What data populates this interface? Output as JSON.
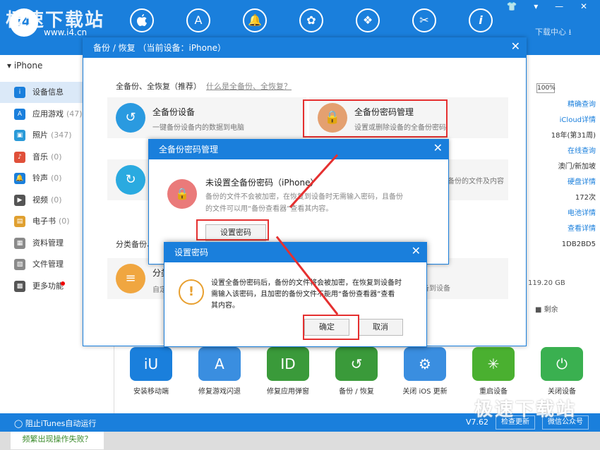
{
  "app": {
    "brand": "极速下载站",
    "url": "www.i4.cn",
    "logo": "i4",
    "download_center": "下载中心 ⭳",
    "window_controls": "👕 ▾ — ✕"
  },
  "nav_icons": [
    "apple-icon",
    "appstore-icon",
    "bell-icon",
    "flower-icon",
    "dropbox-icon",
    "tools-icon",
    "info-icon"
  ],
  "nav_glyphs": [
    "",
    "A",
    "🔔",
    "✿",
    "❖",
    "✂",
    "i"
  ],
  "sidebar": {
    "device": "iPhone",
    "items": [
      {
        "label": "设备信息",
        "count": "",
        "color": "#1a7fdc",
        "glyph": "i"
      },
      {
        "label": "应用游戏",
        "count": "(47)",
        "color": "#1a7fdc",
        "glyph": "A"
      },
      {
        "label": "照片",
        "count": "(347)",
        "color": "#2a9ad8",
        "glyph": "▣"
      },
      {
        "label": "音乐",
        "count": "(0)",
        "color": "#e0503a",
        "glyph": "♪"
      },
      {
        "label": "铃声",
        "count": "(0)",
        "color": "#1a7fdc",
        "glyph": "🔔"
      },
      {
        "label": "视频",
        "count": "(0)",
        "color": "#555555",
        "glyph": "▶"
      },
      {
        "label": "电子书",
        "count": "(0)",
        "color": "#e0a030",
        "glyph": "▤"
      },
      {
        "label": "资料管理",
        "count": "",
        "color": "#8a8a8a",
        "glyph": "▦"
      },
      {
        "label": "文件管理",
        "count": "",
        "color": "#8a8a8a",
        "glyph": "▧"
      },
      {
        "label": "更多功能",
        "count": "",
        "color": "#555555",
        "glyph": "▩"
      }
    ],
    "trouble_button": "频繁出现操作失败？"
  },
  "right_info": {
    "zoom": "100%",
    "lines": [
      "精确查询",
      "iCloud详情",
      "18年(第31周)",
      "在线查询",
      "澳门/新加坡",
      "硬盘详情",
      "172次",
      "电池详情",
      "查看详情",
      "1DB2BD5"
    ],
    "storage": "119.20 GB",
    "remaining": "剩余"
  },
  "tools": [
    {
      "label": "安装移动端",
      "color": "#1a7fdc",
      "glyph": "iU"
    },
    {
      "label": "修复游戏闪退",
      "color": "#3a8ee0",
      "glyph": "A"
    },
    {
      "label": "修复应用弹窗",
      "color": "#3a9a3a",
      "glyph": "ID"
    },
    {
      "label": "备份 / 恢复",
      "color": "#3a9a3a",
      "glyph": "↺"
    },
    {
      "label": "关闭 iOS 更新",
      "color": "#3a8ee0",
      "glyph": "⚙"
    },
    {
      "label": "重启设备",
      "color": "#4ab030",
      "glyph": "✳"
    },
    {
      "label": "关闭设备",
      "color": "#3ab050",
      "glyph": "⏻"
    }
  ],
  "statusbar": {
    "itunes": "阻止iTunes自动运行",
    "version": "V7.62",
    "check_update": "检查更新",
    "wechat": "微信公众号"
  },
  "backup_dialog": {
    "title": "备份 / 恢复   （当前设备：iPhone）",
    "section": "全备份、全恢复（推荐）",
    "help_link": "什么是全备份、全恢复？",
    "card1_title": "全备份设备",
    "card1_sub": "一键备份设备内的数据到电脑",
    "card2_title": "全备份密码管理",
    "card2_sub": "设置或删除设备的全备份密码",
    "card3_sub": "备份的文件及内容",
    "section2": "分类备份、",
    "card4_title": "分类",
    "card4_sub": "自定",
    "card4_side": "备到设备"
  },
  "pwd_dialog": {
    "title": "全备份密码管理",
    "heading": "未设置全备份密码（iPhone）",
    "desc1": "备份的文件不会被加密，在恢复到设备时无需输入密码，且备份",
    "desc2": "的文件可以用“备份查看器”查看其内容。",
    "set_button": "设置密码"
  },
  "set_dialog": {
    "title": "设置密码",
    "msg1": "设置全备份密码后，备份的文件将会被加密，在恢复到设备时",
    "msg2": "需输入该密码，且加密的备份文件不能用“备份查看器”查看",
    "msg3": "其内容。",
    "ok": "确定",
    "cancel": "取消"
  },
  "watermark": "极速下载站"
}
